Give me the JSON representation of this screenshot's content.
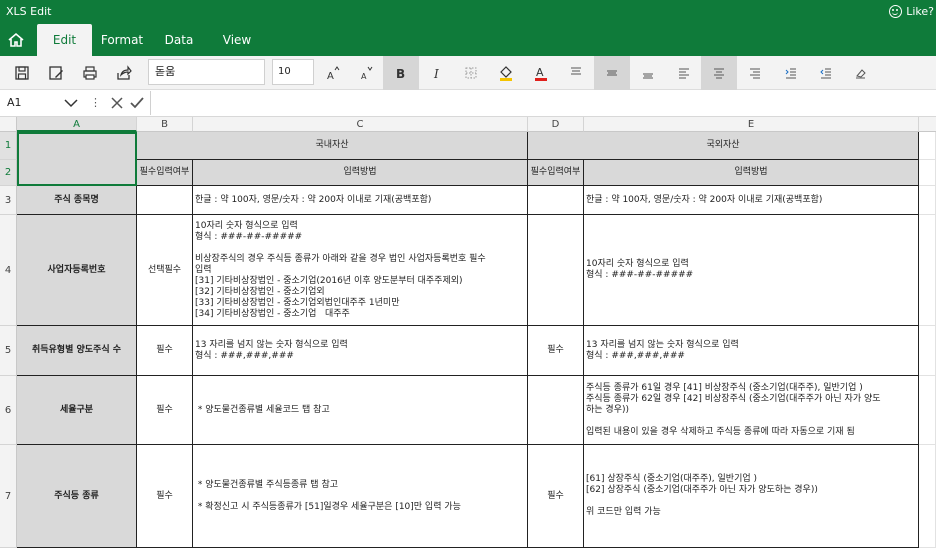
{
  "app": {
    "title": "XLS Edit",
    "like_label": "Like?"
  },
  "tabs": [
    {
      "label": "Edit",
      "active": true
    },
    {
      "label": "Format",
      "active": false
    },
    {
      "label": "Data",
      "active": false
    },
    {
      "label": "View",
      "active": false
    }
  ],
  "toolbar": {
    "font_name": "돋움",
    "font_size": "10",
    "buttons": [
      "save-icon",
      "save-as-icon",
      "print-icon",
      "share-icon",
      "font-grow-icon",
      "font-shrink-icon",
      "bold-icon",
      "italic-icon",
      "borders-icon",
      "fill-color-icon",
      "font-color-icon",
      "align-top-icon",
      "align-middle-icon",
      "align-bottom-icon",
      "align-left-icon",
      "align-center-icon",
      "align-right-icon",
      "indent-increase-icon",
      "indent-decrease-icon",
      "clear-format-icon"
    ],
    "accent_color": "#0f7b3a",
    "font_color_accent": "#e0201b",
    "fill_color_accent": "#f5c400"
  },
  "formula_bar": {
    "cell_ref": "A1",
    "value": ""
  },
  "columns": [
    "A",
    "B",
    "C",
    "D",
    "E"
  ],
  "rows": [
    "1",
    "2",
    "3",
    "4",
    "5",
    "6",
    "7"
  ],
  "header": {
    "domestic": "국내자산",
    "foreign": "국외자산",
    "required": "필수입력여부",
    "method": "입력방법"
  },
  "table": {
    "r3": {
      "label": "주식 종목명",
      "req_domestic": "",
      "method_domestic": "한글 : 약 100자, 영문/숫자 : 약 200자 이내로 기재(공백포함)",
      "req_foreign": "",
      "method_foreign": "한글 : 약 100자, 영문/숫자 : 약 200자 이내로 기재(공백포함)"
    },
    "r4": {
      "label": "사업자등록번호",
      "req_domestic": "선택필수",
      "method_domestic": "10자리 숫자 형식으로 입력\n형식 : ###-##-#####\n\n비상장주식의 경우 주식등 종류가 아래와 같을 경우 법인 사업자등록번호 필수\n입력\n[31] 기타비상장법인 - 중소기업(2016년 이후 양도분부터 대주주제외)\n[32] 기타비상장법인 - 중소기업외\n[33] 기타비상장법인 - 중소기업외법인대주주 1년미만\n[34] 기타비상장법인 - 중소기업   대주주",
      "req_foreign": "",
      "method_foreign": "10자리 숫자 형식으로 입력\n형식 : ###-##-#####"
    },
    "r5": {
      "label": "취득유형별 양도주식 수",
      "req_domestic": "필수",
      "method_domestic": "13 자리를 넘지 않는 숫자 형식으로 입력\n형식 : ###,###,###",
      "req_foreign": "필수",
      "method_foreign": "13 자리를 넘지 않는 숫자 형식으로 입력\n형식 : ###,###,###"
    },
    "r6": {
      "label": "세율구분",
      "req_domestic": "필수",
      "method_domestic": " * 양도물건종류별 세율코드 탭 참고",
      "req_foreign": "",
      "method_foreign": "주식등 종류가 61일 경우 [41] 비상장주식 (중소기업(대주주), 일반기업 )\n주식등 종류가 62일 경우 [42] 비상장주식 (중소기업(대주주가 아닌 자가 양도\n하는 경우))\n\n입력된 내용이 있을 경우 삭제하고 주식등 종류에 따라 자동으로 기재 됨"
    },
    "r7": {
      "label": "주식등 종류",
      "req_domestic": "필수",
      "method_domestic": " * 양도물건종류별 주식등종류 탭 참고\n\n * 확정신고 시 주식등종류가 [51]일경우 세율구분은 [10]만 입력 가능",
      "req_foreign": "필수",
      "method_foreign": "[61] 상장주식 (중소기업(대주주), 일반기업 )\n[62] 상장주식 (중소기업(대주주가 아닌 자가 양도하는 경우))\n\n위 코드만 입력 가능"
    }
  }
}
